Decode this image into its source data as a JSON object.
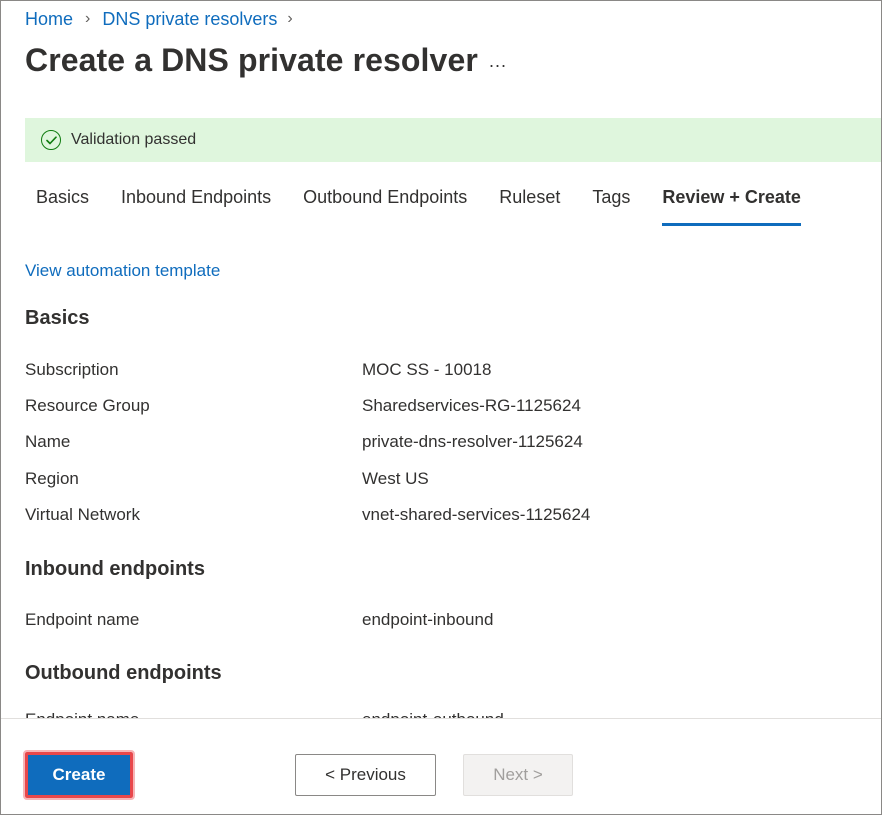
{
  "breadcrumb": {
    "items": [
      "Home",
      "DNS private resolvers"
    ],
    "separator": ">"
  },
  "page": {
    "title": "Create a DNS private resolver",
    "more_label": "..."
  },
  "banner": {
    "icon": "checkmark-circle-icon",
    "message": "Validation passed",
    "color": "#dff6dd"
  },
  "tabs": [
    {
      "label": "Basics",
      "active": false
    },
    {
      "label": "Inbound Endpoints",
      "active": false
    },
    {
      "label": "Outbound Endpoints",
      "active": false
    },
    {
      "label": "Ruleset",
      "active": false
    },
    {
      "label": "Tags",
      "active": false
    },
    {
      "label": "Review + Create",
      "active": true
    }
  ],
  "automation_link": "View automation template",
  "sections": {
    "basics": {
      "heading": "Basics",
      "rows": [
        {
          "key": "Subscription",
          "value": "MOC SS - 10018"
        },
        {
          "key": "Resource Group",
          "value": "Sharedservices-RG-1125624"
        },
        {
          "key": "Name",
          "value": "private-dns-resolver-1125624"
        },
        {
          "key": "Region",
          "value": "West US"
        },
        {
          "key": "Virtual Network",
          "value": "vnet-shared-services-1125624"
        }
      ]
    },
    "inbound": {
      "heading": "Inbound endpoints",
      "rows": [
        {
          "key": "Endpoint name",
          "value": "endpoint-inbound"
        }
      ]
    },
    "outbound": {
      "heading": "Outbound endpoints",
      "rows": [
        {
          "key": "Endpoint name",
          "value": "endpoint-outbound"
        }
      ]
    }
  },
  "footer": {
    "create_label": "Create",
    "previous_label": "< Previous",
    "next_label": "Next >"
  },
  "colors": {
    "accent": "#0f6cbd",
    "highlight": "#e8474b"
  }
}
